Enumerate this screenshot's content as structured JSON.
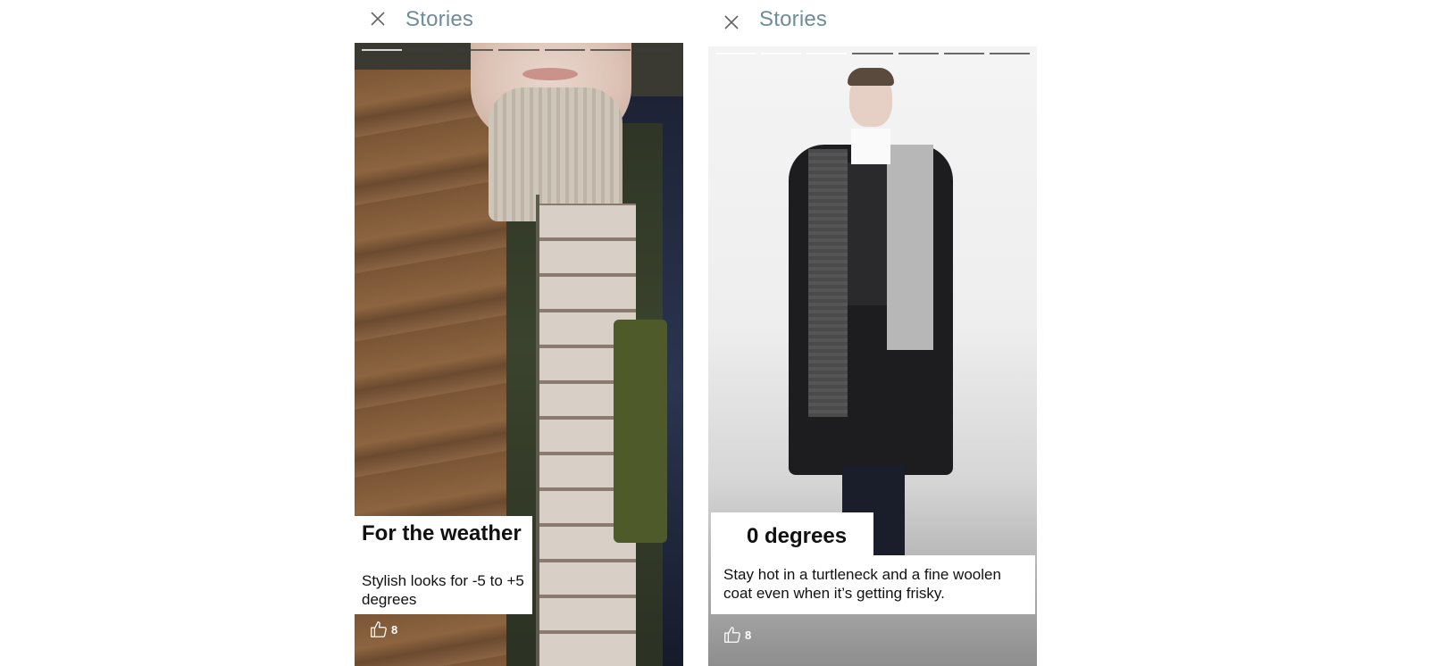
{
  "screens": [
    {
      "header": {
        "title": "Stories",
        "close_icon": "close-icon"
      },
      "progress": {
        "segments": 7,
        "active_index": 1
      },
      "caption": {
        "title": "For the weather",
        "body": "Stylish looks for -5 to +5 degrees"
      },
      "likes": {
        "icon": "thumbs-up-icon",
        "count": "8"
      }
    },
    {
      "header": {
        "title": "Stories",
        "close_icon": "close-icon"
      },
      "progress": {
        "segments": 7,
        "active_index": 3
      },
      "caption": {
        "title": "0 degrees",
        "body": "Stay hot in a  turtleneck and a fine woolen coat even when it’s getting frisky."
      },
      "likes": {
        "icon": "thumbs-up-icon",
        "count": "8"
      }
    }
  ],
  "colors": {
    "title_gray": "#6e8c9c",
    "caption_bg": "#ffffff",
    "caption_text": "#111111"
  }
}
